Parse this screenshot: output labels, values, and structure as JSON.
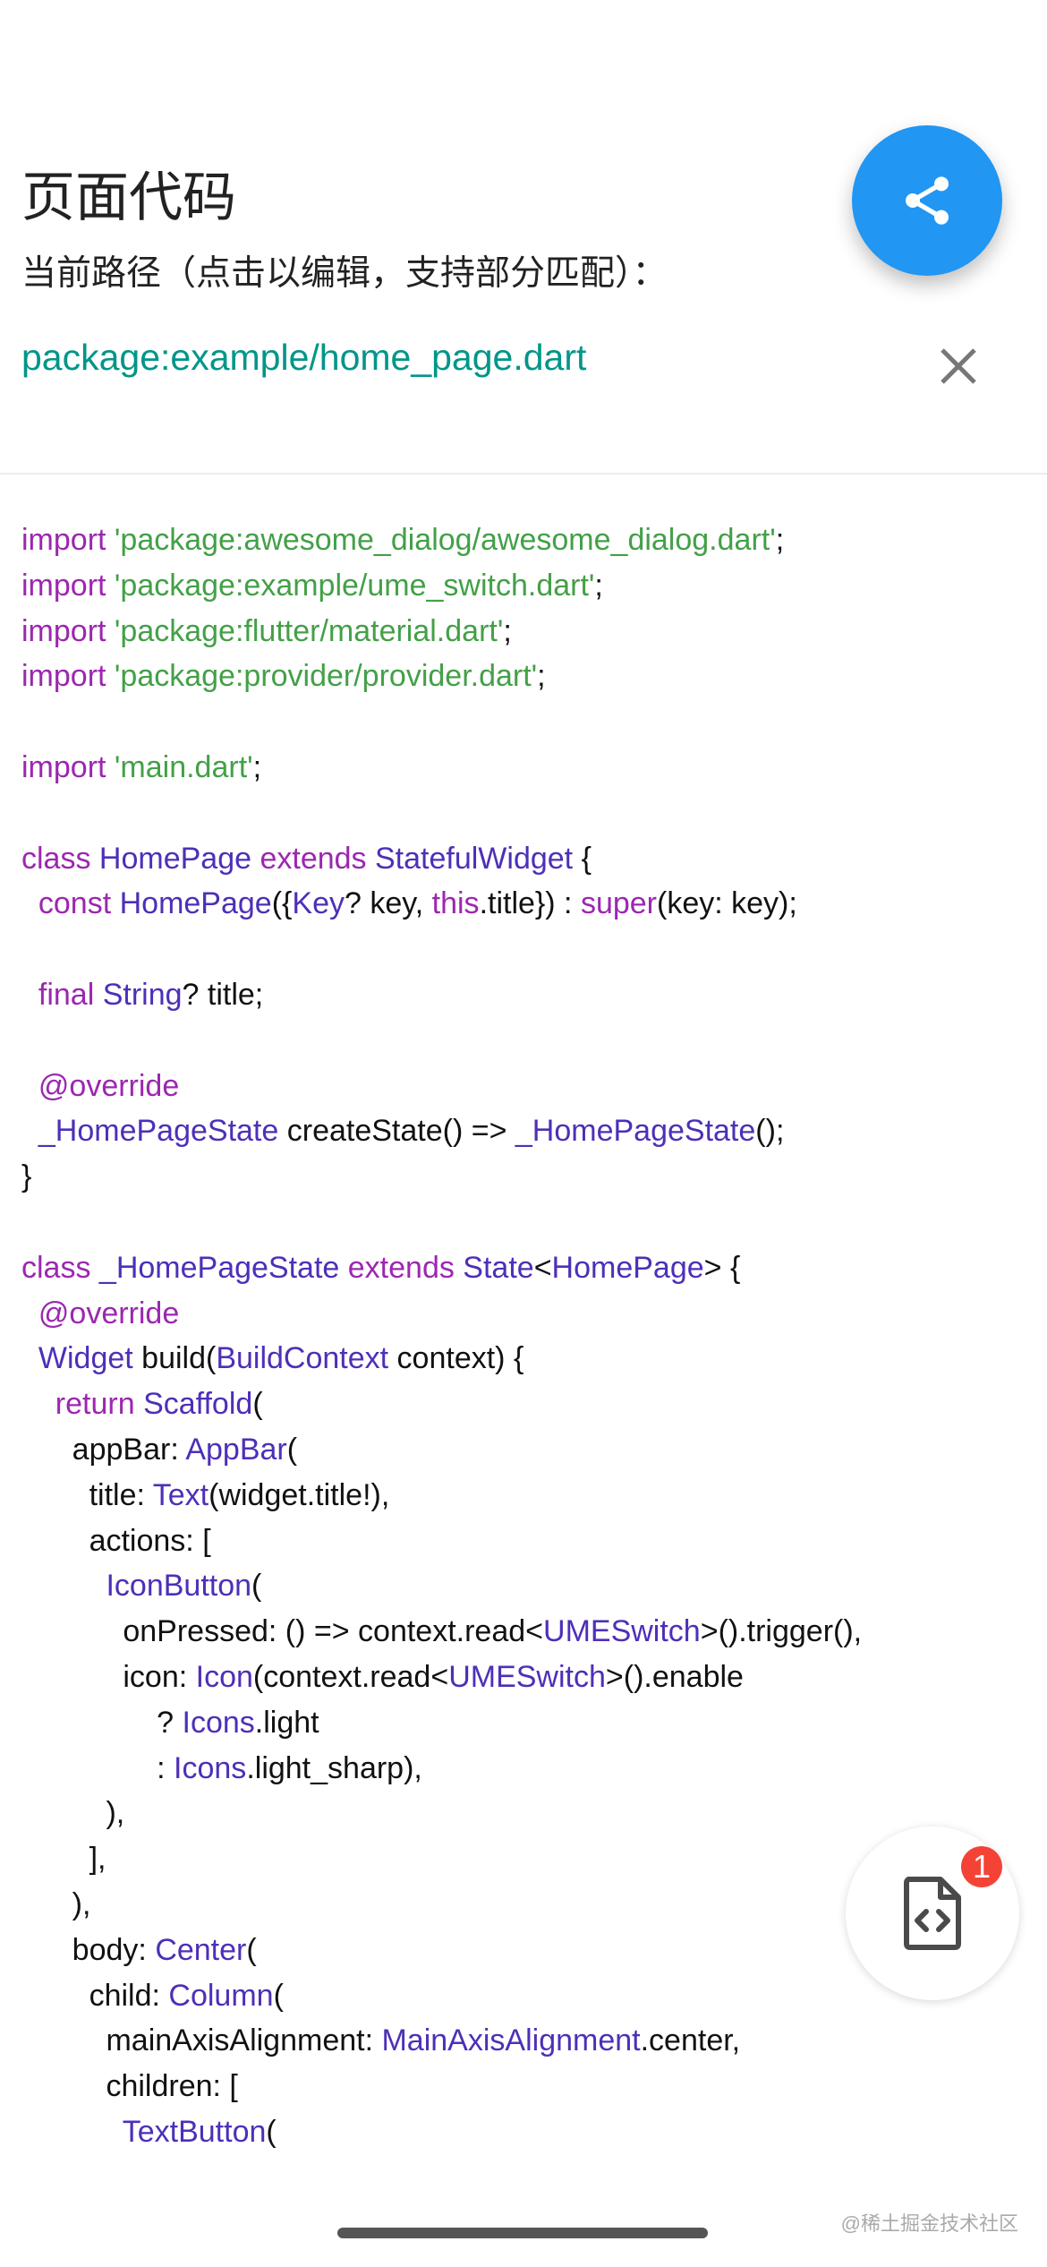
{
  "header": {
    "title": "页面代码",
    "subtitle": "当前路径（点击以编辑，支持部分匹配）：",
    "path": "package:example/home_page.dart"
  },
  "icons": {
    "share": "share-icon",
    "close": "close-icon",
    "code_file": "code-file-icon"
  },
  "colors": {
    "accent": "#2196f3",
    "path": "#009688",
    "keyword": "#9c27b0",
    "type": "#4e2fb8",
    "string": "#43a047",
    "badge": "#f44336"
  },
  "code_lines": [
    [
      [
        "kw",
        "import "
      ],
      [
        "str",
        "'package:awesome_dialog/awesome_dialog.dart'"
      ],
      [
        "pl",
        ";"
      ]
    ],
    [
      [
        "kw",
        "import "
      ],
      [
        "str",
        "'package:example/ume_switch.dart'"
      ],
      [
        "pl",
        ";"
      ]
    ],
    [
      [
        "kw",
        "import "
      ],
      [
        "str",
        "'package:flutter/material.dart'"
      ],
      [
        "pl",
        ";"
      ]
    ],
    [
      [
        "kw",
        "import "
      ],
      [
        "str",
        "'package:provider/provider.dart'"
      ],
      [
        "pl",
        ";"
      ]
    ],
    [],
    [
      [
        "kw",
        "import "
      ],
      [
        "str",
        "'main.dart'"
      ],
      [
        "pl",
        ";"
      ]
    ],
    [],
    [
      [
        "kw",
        "class "
      ],
      [
        "ty",
        "HomePage "
      ],
      [
        "kw",
        "extends "
      ],
      [
        "ty",
        "StatefulWidget"
      ],
      [
        "pl",
        " {"
      ]
    ],
    [
      [
        "kw",
        "  const "
      ],
      [
        "ty",
        "HomePage"
      ],
      [
        "pl",
        "({"
      ],
      [
        "ty",
        "Key"
      ],
      [
        "pl",
        "? key, "
      ],
      [
        "kw",
        "this"
      ],
      [
        "pl",
        ".title}) : "
      ],
      [
        "kw",
        "super"
      ],
      [
        "pl",
        "(key: key);"
      ]
    ],
    [],
    [
      [
        "kw",
        "  final "
      ],
      [
        "ty",
        "String"
      ],
      [
        "pl",
        "? title;"
      ]
    ],
    [],
    [
      [
        "kw",
        "  @override"
      ]
    ],
    [
      [
        "ty",
        "  _HomePageState"
      ],
      [
        "pl",
        " createState() => "
      ],
      [
        "ty",
        "_HomePageState"
      ],
      [
        "pl",
        "();"
      ]
    ],
    [
      [
        "pl",
        "}"
      ]
    ],
    [],
    [
      [
        "kw",
        "class "
      ],
      [
        "ty",
        "_HomePageState "
      ],
      [
        "kw",
        "extends "
      ],
      [
        "ty",
        "State"
      ],
      [
        "pl",
        "<"
      ],
      [
        "ty",
        "HomePage"
      ],
      [
        "pl",
        "> {"
      ]
    ],
    [
      [
        "kw",
        "  @override"
      ]
    ],
    [
      [
        "ty",
        "  Widget"
      ],
      [
        "pl",
        " build("
      ],
      [
        "ty",
        "BuildContext"
      ],
      [
        "pl",
        " context) {"
      ]
    ],
    [
      [
        "kw",
        "    return "
      ],
      [
        "ty",
        "Scaffold"
      ],
      [
        "pl",
        "("
      ]
    ],
    [
      [
        "pl",
        "      appBar: "
      ],
      [
        "ty",
        "AppBar"
      ],
      [
        "pl",
        "("
      ]
    ],
    [
      [
        "pl",
        "        title: "
      ],
      [
        "ty",
        "Text"
      ],
      [
        "pl",
        "(widget.title!),"
      ]
    ],
    [
      [
        "pl",
        "        actions: ["
      ]
    ],
    [
      [
        "ty",
        "          IconButton"
      ],
      [
        "pl",
        "("
      ]
    ],
    [
      [
        "pl",
        "            onPressed: () => context.read<"
      ],
      [
        "ty",
        "UMESwitch"
      ],
      [
        "pl",
        ">().trigger(),"
      ]
    ],
    [
      [
        "pl",
        "            icon: "
      ],
      [
        "ty",
        "Icon"
      ],
      [
        "pl",
        "(context.read<"
      ],
      [
        "ty",
        "UMESwitch"
      ],
      [
        "pl",
        ">().enable"
      ]
    ],
    [
      [
        "pl",
        "                ? "
      ],
      [
        "ty",
        "Icons"
      ],
      [
        "pl",
        ".light"
      ]
    ],
    [
      [
        "pl",
        "                : "
      ],
      [
        "ty",
        "Icons"
      ],
      [
        "pl",
        ".light_sharp),"
      ]
    ],
    [
      [
        "pl",
        "          ),"
      ]
    ],
    [
      [
        "pl",
        "        ],"
      ]
    ],
    [
      [
        "pl",
        "      ),"
      ]
    ],
    [
      [
        "pl",
        "      body: "
      ],
      [
        "ty",
        "Center"
      ],
      [
        "pl",
        "("
      ]
    ],
    [
      [
        "pl",
        "        child: "
      ],
      [
        "ty",
        "Column"
      ],
      [
        "pl",
        "("
      ]
    ],
    [
      [
        "pl",
        "          mainAxisAlignment: "
      ],
      [
        "ty",
        "MainAxisAlignment"
      ],
      [
        "pl",
        ".center,"
      ]
    ],
    [
      [
        "pl",
        "          children: ["
      ]
    ],
    [
      [
        "ty",
        "            TextButton"
      ],
      [
        "pl",
        "("
      ]
    ]
  ],
  "badge_count": "1",
  "watermark": "@稀土掘金技术社区"
}
